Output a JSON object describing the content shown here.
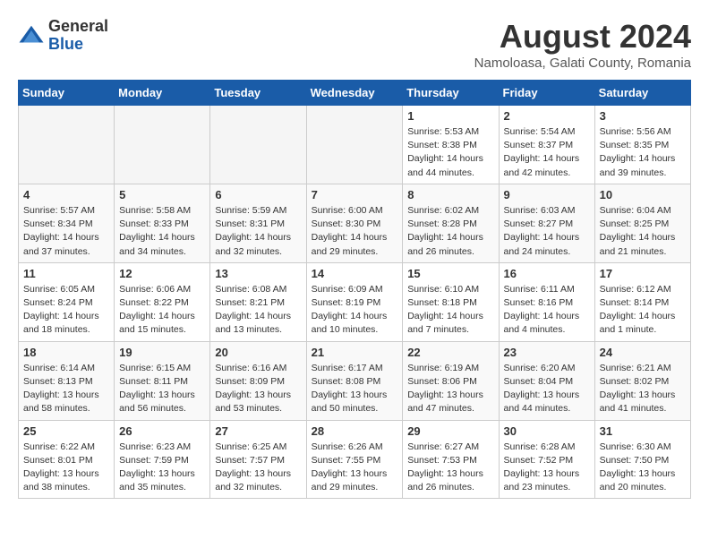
{
  "logo": {
    "general": "General",
    "blue": "Blue"
  },
  "title": {
    "month_year": "August 2024",
    "location": "Namoloasa, Galati County, Romania"
  },
  "headers": [
    "Sunday",
    "Monday",
    "Tuesday",
    "Wednesday",
    "Thursday",
    "Friday",
    "Saturday"
  ],
  "weeks": [
    [
      {
        "day": "",
        "info": ""
      },
      {
        "day": "",
        "info": ""
      },
      {
        "day": "",
        "info": ""
      },
      {
        "day": "",
        "info": ""
      },
      {
        "day": "1",
        "info": "Sunrise: 5:53 AM\nSunset: 8:38 PM\nDaylight: 14 hours\nand 44 minutes."
      },
      {
        "day": "2",
        "info": "Sunrise: 5:54 AM\nSunset: 8:37 PM\nDaylight: 14 hours\nand 42 minutes."
      },
      {
        "day": "3",
        "info": "Sunrise: 5:56 AM\nSunset: 8:35 PM\nDaylight: 14 hours\nand 39 minutes."
      }
    ],
    [
      {
        "day": "4",
        "info": "Sunrise: 5:57 AM\nSunset: 8:34 PM\nDaylight: 14 hours\nand 37 minutes."
      },
      {
        "day": "5",
        "info": "Sunrise: 5:58 AM\nSunset: 8:33 PM\nDaylight: 14 hours\nand 34 minutes."
      },
      {
        "day": "6",
        "info": "Sunrise: 5:59 AM\nSunset: 8:31 PM\nDaylight: 14 hours\nand 32 minutes."
      },
      {
        "day": "7",
        "info": "Sunrise: 6:00 AM\nSunset: 8:30 PM\nDaylight: 14 hours\nand 29 minutes."
      },
      {
        "day": "8",
        "info": "Sunrise: 6:02 AM\nSunset: 8:28 PM\nDaylight: 14 hours\nand 26 minutes."
      },
      {
        "day": "9",
        "info": "Sunrise: 6:03 AM\nSunset: 8:27 PM\nDaylight: 14 hours\nand 24 minutes."
      },
      {
        "day": "10",
        "info": "Sunrise: 6:04 AM\nSunset: 8:25 PM\nDaylight: 14 hours\nand 21 minutes."
      }
    ],
    [
      {
        "day": "11",
        "info": "Sunrise: 6:05 AM\nSunset: 8:24 PM\nDaylight: 14 hours\nand 18 minutes."
      },
      {
        "day": "12",
        "info": "Sunrise: 6:06 AM\nSunset: 8:22 PM\nDaylight: 14 hours\nand 15 minutes."
      },
      {
        "day": "13",
        "info": "Sunrise: 6:08 AM\nSunset: 8:21 PM\nDaylight: 14 hours\nand 13 minutes."
      },
      {
        "day": "14",
        "info": "Sunrise: 6:09 AM\nSunset: 8:19 PM\nDaylight: 14 hours\nand 10 minutes."
      },
      {
        "day": "15",
        "info": "Sunrise: 6:10 AM\nSunset: 8:18 PM\nDaylight: 14 hours\nand 7 minutes."
      },
      {
        "day": "16",
        "info": "Sunrise: 6:11 AM\nSunset: 8:16 PM\nDaylight: 14 hours\nand 4 minutes."
      },
      {
        "day": "17",
        "info": "Sunrise: 6:12 AM\nSunset: 8:14 PM\nDaylight: 14 hours\nand 1 minute."
      }
    ],
    [
      {
        "day": "18",
        "info": "Sunrise: 6:14 AM\nSunset: 8:13 PM\nDaylight: 13 hours\nand 58 minutes."
      },
      {
        "day": "19",
        "info": "Sunrise: 6:15 AM\nSunset: 8:11 PM\nDaylight: 13 hours\nand 56 minutes."
      },
      {
        "day": "20",
        "info": "Sunrise: 6:16 AM\nSunset: 8:09 PM\nDaylight: 13 hours\nand 53 minutes."
      },
      {
        "day": "21",
        "info": "Sunrise: 6:17 AM\nSunset: 8:08 PM\nDaylight: 13 hours\nand 50 minutes."
      },
      {
        "day": "22",
        "info": "Sunrise: 6:19 AM\nSunset: 8:06 PM\nDaylight: 13 hours\nand 47 minutes."
      },
      {
        "day": "23",
        "info": "Sunrise: 6:20 AM\nSunset: 8:04 PM\nDaylight: 13 hours\nand 44 minutes."
      },
      {
        "day": "24",
        "info": "Sunrise: 6:21 AM\nSunset: 8:02 PM\nDaylight: 13 hours\nand 41 minutes."
      }
    ],
    [
      {
        "day": "25",
        "info": "Sunrise: 6:22 AM\nSunset: 8:01 PM\nDaylight: 13 hours\nand 38 minutes."
      },
      {
        "day": "26",
        "info": "Sunrise: 6:23 AM\nSunset: 7:59 PM\nDaylight: 13 hours\nand 35 minutes."
      },
      {
        "day": "27",
        "info": "Sunrise: 6:25 AM\nSunset: 7:57 PM\nDaylight: 13 hours\nand 32 minutes."
      },
      {
        "day": "28",
        "info": "Sunrise: 6:26 AM\nSunset: 7:55 PM\nDaylight: 13 hours\nand 29 minutes."
      },
      {
        "day": "29",
        "info": "Sunrise: 6:27 AM\nSunset: 7:53 PM\nDaylight: 13 hours\nand 26 minutes."
      },
      {
        "day": "30",
        "info": "Sunrise: 6:28 AM\nSunset: 7:52 PM\nDaylight: 13 hours\nand 23 minutes."
      },
      {
        "day": "31",
        "info": "Sunrise: 6:30 AM\nSunset: 7:50 PM\nDaylight: 13 hours\nand 20 minutes."
      }
    ]
  ]
}
